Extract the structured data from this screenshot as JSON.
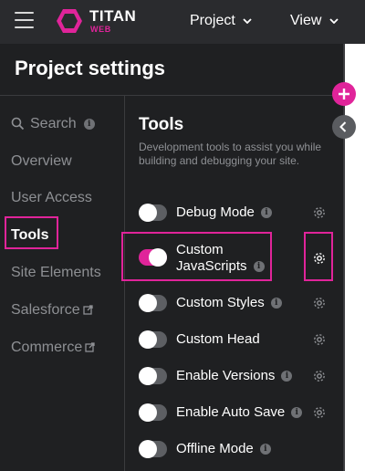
{
  "topbar": {
    "logo_title": "TITAN",
    "logo_sub": "WEB",
    "menus": [
      {
        "label": "Project"
      },
      {
        "label": "View"
      }
    ]
  },
  "panel": {
    "title": "Project settings"
  },
  "nav": {
    "search_label": "Search",
    "items": [
      {
        "label": "Overview"
      },
      {
        "label": "User Access"
      },
      {
        "label": "Tools"
      },
      {
        "label": "Site Elements"
      },
      {
        "label": "Salesforce"
      },
      {
        "label": "Commerce"
      }
    ],
    "active": "Tools"
  },
  "tools": {
    "heading": "Tools",
    "description": "Development tools to assist you while building and debugging your site.",
    "items": [
      {
        "label": "Debug Mode",
        "enabled": false,
        "has_settings": true
      },
      {
        "label": "Custom JavaScripts",
        "label_line1": "Custom",
        "label_line2": "JavaScripts",
        "enabled": true,
        "has_settings": true
      },
      {
        "label": "Custom Styles",
        "enabled": false,
        "has_settings": true
      },
      {
        "label": "Custom Head",
        "enabled": false,
        "has_settings": true
      },
      {
        "label": "Enable Versions",
        "enabled": false,
        "has_settings": true
      },
      {
        "label": "Enable Auto Save",
        "enabled": false,
        "has_settings": true
      },
      {
        "label": "Offline Mode",
        "enabled": false,
        "has_settings": false
      }
    ]
  },
  "info_glyph": "i",
  "colors": {
    "accent": "#e0249a",
    "background": "#1f2022",
    "topbar": "#2a2b2e",
    "muted_text": "#8e9094"
  },
  "icons": {
    "menu": "hamburger-icon",
    "search": "search-icon",
    "external": "external-link-icon",
    "settings": "gear-icon",
    "add": "plus-icon",
    "collapse": "chevron-left-icon"
  }
}
